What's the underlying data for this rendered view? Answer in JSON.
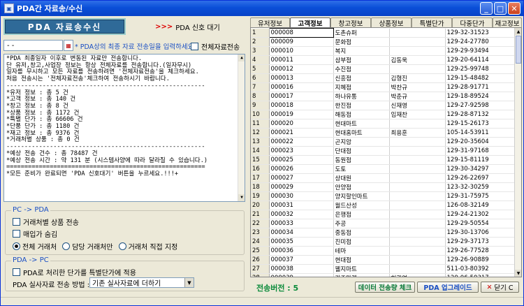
{
  "window": {
    "title": "PDA간 자료송/수신"
  },
  "left": {
    "send_button": "PDA 자료송수신",
    "wait_button": "PDA 신호 대기",
    "wait_arrow": ">>>",
    "date_value": "- -",
    "date_hint": "* PDA상의 최종 자료 전송일을 입력하세요.",
    "full_send_label": "전체자료전송",
    "log_lines": [
      "*PDA 최종일자 이후로 변동된 자료만 전송합니다.",
      "단 유저,창고,사업장 정보는 항상 전체자료를 전송합니다.(일자무시)",
      "",
      "일자를 무시하고 모든 자료를 전송하려면 '전체자료전송'을 체크하세요.",
      "처음 전송시는 '전체자료전송'체크하여 전송하시기 바랍니다.",
      "-------------------------------------------------------",
      "*유저 정보 : 총 5 건",
      "*고객 정보 : 총 140 건",
      "*창고 정보 : 총 8 건",
      "*상품 정보 : 총 1172 건",
      "*특별 단가 : 총 66606 건",
      "*단품 단가 : 총 1180 건",
      "*재고 정보 : 총 9376 건",
      "*거래처별 상품 : 총 0 건",
      "-------------------------------------------------------",
      "*예상 전송 건수 : 총 78487 건",
      "*예상 전송 시간 : 약 131 분 (시스템사양에 따라 달라질 수 있습니다.)",
      "=======================================================",
      "*모든 준비가 완료되면 'PDA 신호대기' 버튼을 누르세요.!!!+"
    ],
    "pc_to_pda": {
      "legend": "PC -> PDA",
      "opt1": "거래처별 상품 전송",
      "opt2": "매입가 숨김",
      "radios": [
        "전체 거래처",
        "담당 거래처만",
        "거래처 직접 지정"
      ]
    },
    "pda_to_pc": {
      "legend": "PDA -> PC",
      "opt1": "PDA로 처리한 단가를 특별단가에 적용",
      "method_label": "PDA 실사자료 전송 방법 :",
      "method_value": "기존 실사자료에 더하기"
    }
  },
  "right": {
    "tabs": [
      "유저정보",
      "고객정보",
      "창고정보",
      "상품정보",
      "특별단가",
      "다중단가",
      "재고정보"
    ],
    "rows": [
      [
        "1",
        "000008",
        "도촌슈퍼",
        "",
        "129-32-31523"
      ],
      [
        "2",
        "000009",
        "문화점",
        "",
        "129-24-27780"
      ],
      [
        "3",
        "000010",
        "복지",
        "",
        "129-29-93494"
      ],
      [
        "4",
        "000011",
        "삼부점",
        "김동욱",
        "129-20-64114"
      ],
      [
        "5",
        "000012",
        "수진점",
        "",
        "129-25-99748"
      ],
      [
        "6",
        "000013",
        "신흥점",
        "김형진",
        "129-15-48482"
      ],
      [
        "7",
        "000016",
        "지혜점",
        "박찬규",
        "129-28-91771"
      ],
      [
        "8",
        "000017",
        "하나유통",
        "박춘규",
        "129-18-89524"
      ],
      [
        "9",
        "000018",
        "한진점",
        "신재영",
        "129-27-92598"
      ],
      [
        "10",
        "000019",
        "해동점",
        "임재찬",
        "129-28-87132"
      ],
      [
        "11",
        "000020",
        "현대마트",
        "",
        "129-15-26173"
      ],
      [
        "12",
        "000021",
        "현대홈마트",
        "최용훈",
        "105-14-53911"
      ],
      [
        "13",
        "000022",
        "곤지암",
        "",
        "129-20-35604"
      ],
      [
        "14",
        "000023",
        "단대점",
        "",
        "129-31-97168"
      ],
      [
        "15",
        "000025",
        "동원점",
        "",
        "129-15-81119"
      ],
      [
        "16",
        "000026",
        "도토",
        "",
        "129-30-34297"
      ],
      [
        "17",
        "000027",
        "상대원",
        "",
        "129-26-22697"
      ],
      [
        "18",
        "000029",
        "안양점",
        "",
        "123-32-30259"
      ],
      [
        "19",
        "000030",
        "양지할인마트",
        "",
        "129-31-75975"
      ],
      [
        "20",
        "000031",
        "월드산성",
        "",
        "126-08-32149"
      ],
      [
        "21",
        "000032",
        "은행점",
        "",
        "129-24-21302"
      ],
      [
        "22",
        "000033",
        "주공",
        "",
        "129-29-50554"
      ],
      [
        "23",
        "000034",
        "중동점",
        "",
        "129-30-13706"
      ],
      [
        "24",
        "000035",
        "진미점",
        "",
        "129-29-37173"
      ],
      [
        "25",
        "000036",
        "테마",
        "",
        "129-26-77528"
      ],
      [
        "26",
        "000037",
        "현대점",
        "",
        "129-26-90889"
      ],
      [
        "27",
        "000038",
        "웰지마트",
        "",
        "511-03-80392"
      ],
      [
        "28",
        "000039",
        "가주마켓",
        "허광영",
        "120-06-59317"
      ],
      [
        "29",
        "000042",
        "광림",
        "장경옥",
        "220-03-37081"
      ]
    ],
    "version_label": "전송버전 : 5",
    "btn_check": "데이터 전송량 체크",
    "btn_upgrade": "PDA 업그레이드",
    "btn_close": "닫기 C"
  }
}
